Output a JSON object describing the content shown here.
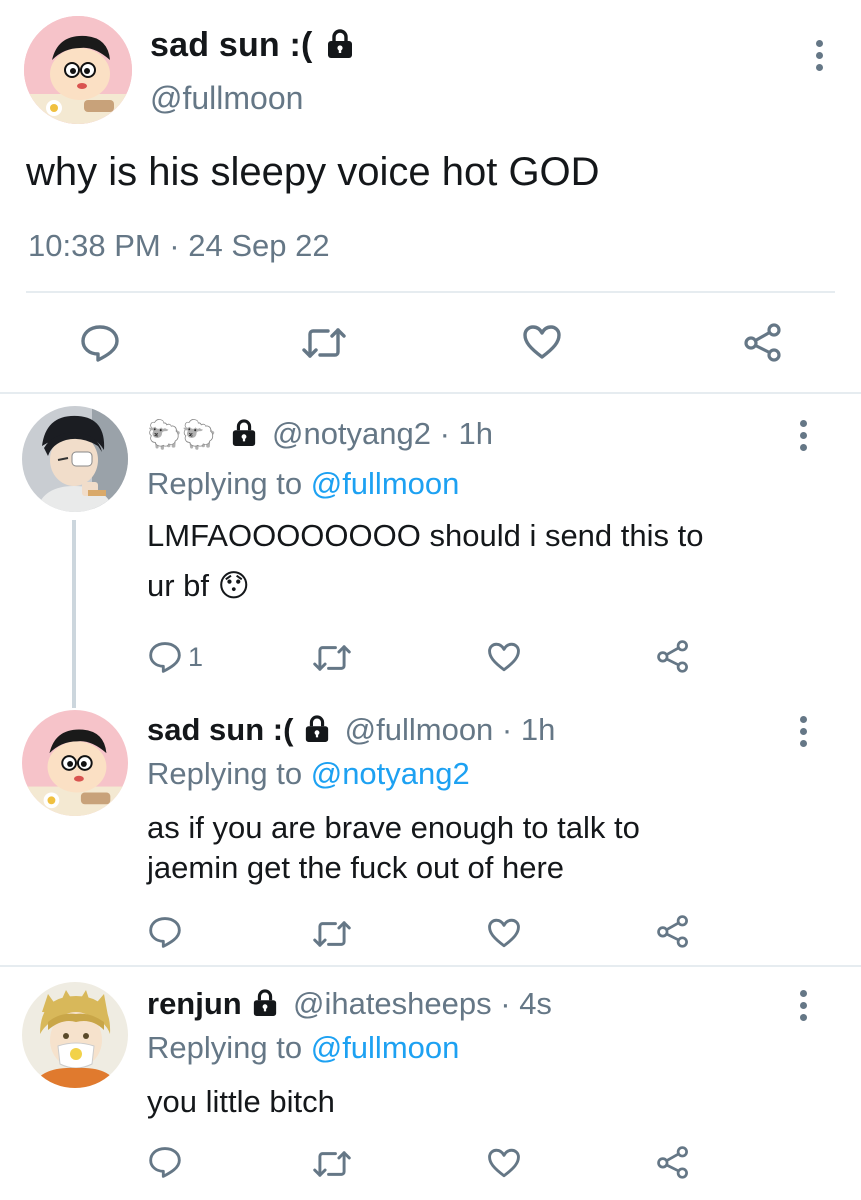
{
  "main_tweet": {
    "name": "sad sun :(",
    "handle": "@fullmoon",
    "text": "why is his sleepy voice hot GOD",
    "timestamp": "10:38 PM · 24 Sep 22"
  },
  "replies": [
    {
      "name_emoji": "🐑🐑",
      "handle_time": "@notyang2 · 1h",
      "replying_prefix": "Replying to",
      "replying_to": "@fullmoon",
      "line1": "LMFAOOOOOOOO should i send this to",
      "line2": "ur bf 😯",
      "reply_count": "1"
    },
    {
      "name": "sad sun :(",
      "handle_time": "@fullmoon · 1h",
      "replying_prefix": "Replying to",
      "replying_to": "@notyang2",
      "line1": "as if you are brave enough to talk to",
      "line2": "jaemin get the fuck out of here"
    },
    {
      "name": "renjun",
      "handle_time": "@ihatesheeps · 4s",
      "replying_prefix": "Replying to",
      "replying_to": "@fullmoon",
      "line1": "you little bitch"
    }
  ],
  "icons": {
    "reply": "reply-icon",
    "retweet": "retweet-icon",
    "like": "like-icon",
    "share": "share-icon",
    "lock": "lock-icon",
    "more": "more-icon"
  },
  "colors": {
    "text": "#14171a",
    "secondary": "#657786",
    "link": "#1da1f2",
    "divider": "#e6ecf0"
  }
}
